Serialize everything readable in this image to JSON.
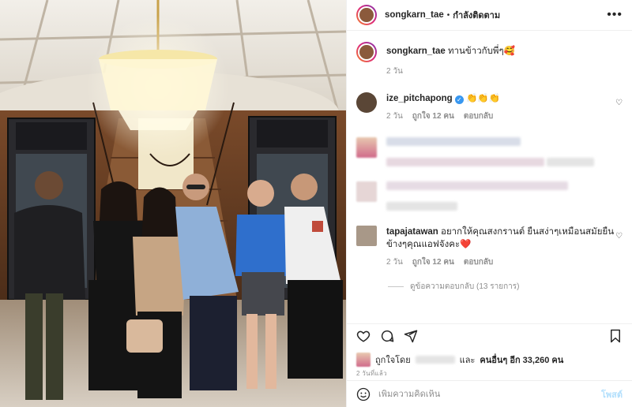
{
  "header": {
    "username": "songkarn_tae",
    "separator": "•",
    "follow_status": "กำลังติดตาม",
    "more": "•••"
  },
  "caption": {
    "username": "songkarn_tae",
    "text": "ทานข้าวกับพี่ๆ🥰",
    "time": "2 วัน"
  },
  "comments": [
    {
      "username": "ize_pitchapong",
      "verified_mark": "✓",
      "text": "👏👏👏",
      "time": "2 วัน",
      "likes": "ถูกใจ 12 คน",
      "reply": "ตอบกลับ"
    },
    {
      "username": "tapajatawan",
      "text": "อยากให้คุณสงกรานต์ ยืนสง่าๆเหมือนสมัยยืนข้างๆคุณแอฟจังคะ❤️",
      "time": "2 วัน",
      "likes": "ถูกใจ 12 คน",
      "reply": "ตอบกลับ"
    }
  ],
  "view_replies": "ดูข้อความตอบกลับ (13 รายการ)",
  "likes_line": {
    "prefix": "ถูกใจโดย",
    "and": "และ",
    "others": "คนอื่นๆ อีก 33,260 คน"
  },
  "post_time": "2 วันที่แล้ว",
  "add_comment": {
    "placeholder": "เพิ่มความคิดเห็น",
    "post_label": "โพสต์",
    "emoji_icon": "emoji-icon"
  },
  "icons": [
    "heart-icon",
    "comment-icon",
    "share-icon",
    "bookmark-icon",
    "more-icon"
  ],
  "colors": {
    "link_blue": "#3897f0",
    "post_button_disabled": "#b2dffc",
    "heart_red": "#ed4956"
  }
}
